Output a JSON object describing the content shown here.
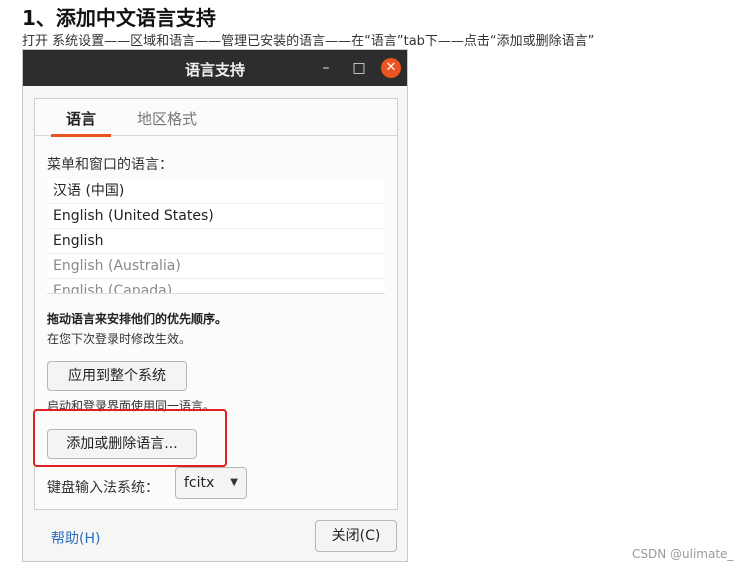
{
  "doc": {
    "title": "1、添加中文语言支持",
    "subtitle": "打开 系统设置——区域和语言——管理已安装的语言——在“语言”tab下——点击“添加或删除语言”"
  },
  "window": {
    "title": "语言支持",
    "minimize_glyph": "–",
    "maximize_glyph": "□",
    "close_glyph": "✕",
    "accent_color": "#e95420"
  },
  "tabs": [
    {
      "label": "语言",
      "selected": true
    },
    {
      "label": "地区格式",
      "selected": false
    }
  ],
  "language_tab": {
    "menu_label": "菜单和窗口的语言：",
    "languages": [
      {
        "label": "汉语 (中国)",
        "dim": false
      },
      {
        "label": "English (United States)",
        "dim": false
      },
      {
        "label": "English",
        "dim": false
      },
      {
        "label": "English (Australia)",
        "dim": true
      },
      {
        "label": "English (Canada)",
        "dim": true
      }
    ],
    "drag_hint": "拖动语言来安排他们的优先顺序。",
    "drag_subhint": "在您下次登录时修改生效。",
    "apply_button": "应用到整个系统",
    "login_hint": "启动和登录界面使用同一语言。",
    "add_remove_button": "添加或删除语言...",
    "ime_label": "键盘输入法系统：",
    "ime_value": "fcitx",
    "ime_arrow": "▼"
  },
  "footer": {
    "help_link": "帮助(H)",
    "close_button": "关闭(C)"
  },
  "watermark": "CSDN @ulimate_"
}
